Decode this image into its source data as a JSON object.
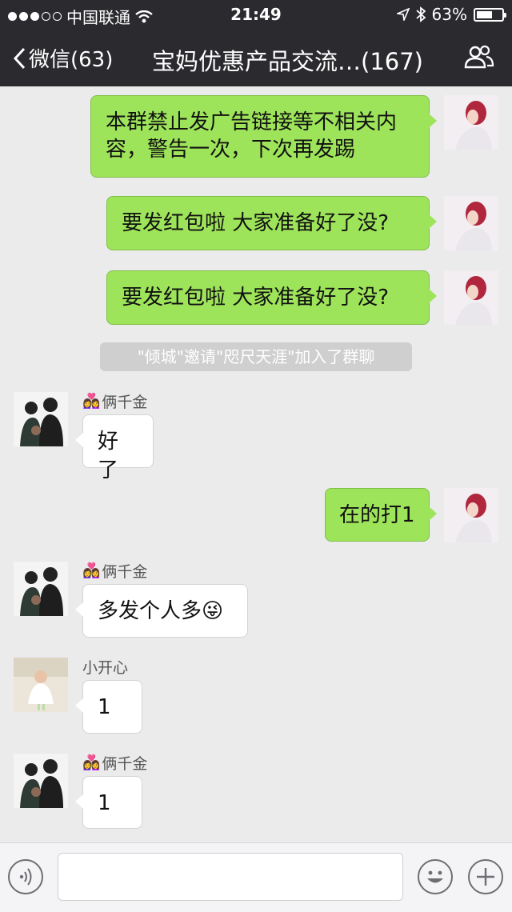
{
  "status_bar": {
    "carrier": "中国联通",
    "time": "21:49",
    "battery": "63%",
    "battery_level": 0.63
  },
  "nav": {
    "back_label": "微信(63)",
    "title": "宝妈优惠产品交流…(167)"
  },
  "messages": [
    {
      "side": "right",
      "sender": "",
      "text": "本群禁止发广告链接等不相关内容，警告一次，下次再发踢"
    },
    {
      "side": "right",
      "sender": "",
      "text": "要发红包啦 大家准备好了没?"
    },
    {
      "side": "right",
      "sender": "",
      "text": "要发红包啦 大家准备好了没?"
    },
    {
      "type": "system",
      "text": "\"倾城\"邀请\"咫尺天涯\"加入了群聊"
    },
    {
      "side": "left",
      "sender": "俩千金",
      "text": "好了"
    },
    {
      "side": "right",
      "sender": "",
      "text": "在的打1"
    },
    {
      "side": "left",
      "sender": "俩千金",
      "text": "多发个人多",
      "emoji": "😜"
    },
    {
      "side": "left",
      "sender": "小开心",
      "text": "1"
    },
    {
      "side": "left",
      "sender": "俩千金",
      "text": "1"
    }
  ],
  "input": {
    "placeholder": ""
  },
  "icons": {
    "voice": "voice-icon",
    "emoji": "emoji-icon",
    "plus": "plus-icon",
    "group": "group-members-icon",
    "back": "chevron-left-icon"
  }
}
